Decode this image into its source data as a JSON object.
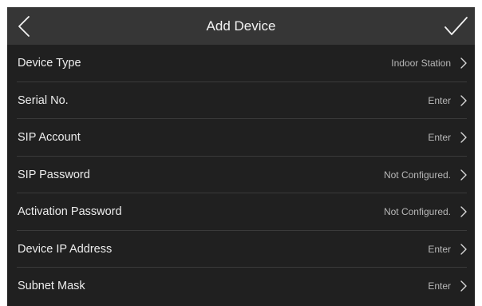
{
  "header": {
    "title": "Add Device",
    "back_icon": "chevron-left-icon",
    "confirm_icon": "checkmark-icon"
  },
  "colors": {
    "background": "#202020",
    "header": "#363636",
    "text": "#ececec",
    "value_text": "#b8b8b8",
    "divider": "#3a3a3a"
  },
  "rows": [
    {
      "label": "Device Type",
      "value": "Indoor Station"
    },
    {
      "label": "Serial No.",
      "value": "Enter"
    },
    {
      "label": "SIP Account",
      "value": "Enter"
    },
    {
      "label": "SIP Password",
      "value": "Not Configured."
    },
    {
      "label": "Activation Password",
      "value": "Not Configured."
    },
    {
      "label": "Device IP Address",
      "value": "Enter"
    },
    {
      "label": "Subnet Mask",
      "value": "Enter"
    }
  ]
}
